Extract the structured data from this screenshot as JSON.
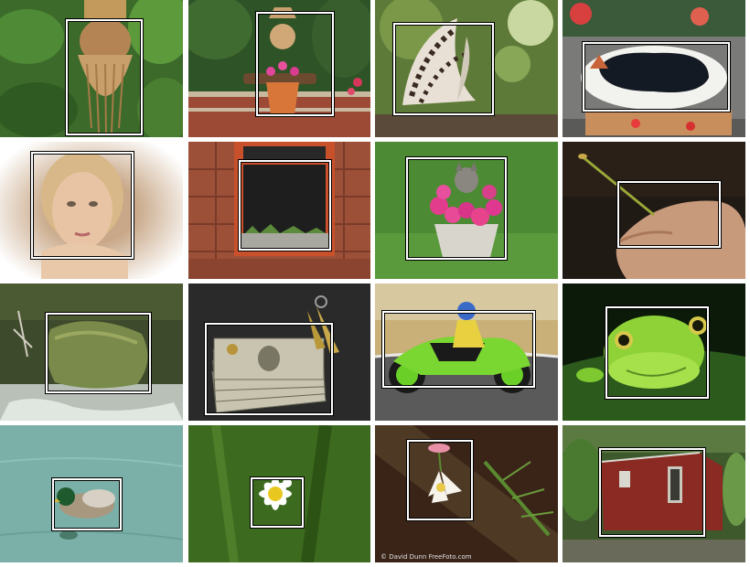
{
  "grid": {
    "tiles": [
      {
        "subject": "carved-wooden-face"
      },
      {
        "subject": "garden-scarecrow-with-flower-pot"
      },
      {
        "subject": "butterfly"
      },
      {
        "subject": "black-pond-fountain"
      },
      {
        "subject": "girl-portrait"
      },
      {
        "subject": "brick-wall-window"
      },
      {
        "subject": "cat-in-flower-pot"
      },
      {
        "subject": "hand-holding-stem"
      },
      {
        "subject": "mossy-rock"
      },
      {
        "subject": "money-and-keys"
      },
      {
        "subject": "motorcycle-racer"
      },
      {
        "subject": "green-frog"
      },
      {
        "subject": "mallard-duck"
      },
      {
        "subject": "white-daisy"
      },
      {
        "subject": "white-lily"
      },
      {
        "subject": "red-shed"
      }
    ],
    "credit_text": "© David Dunn  FreeFoto.com"
  }
}
